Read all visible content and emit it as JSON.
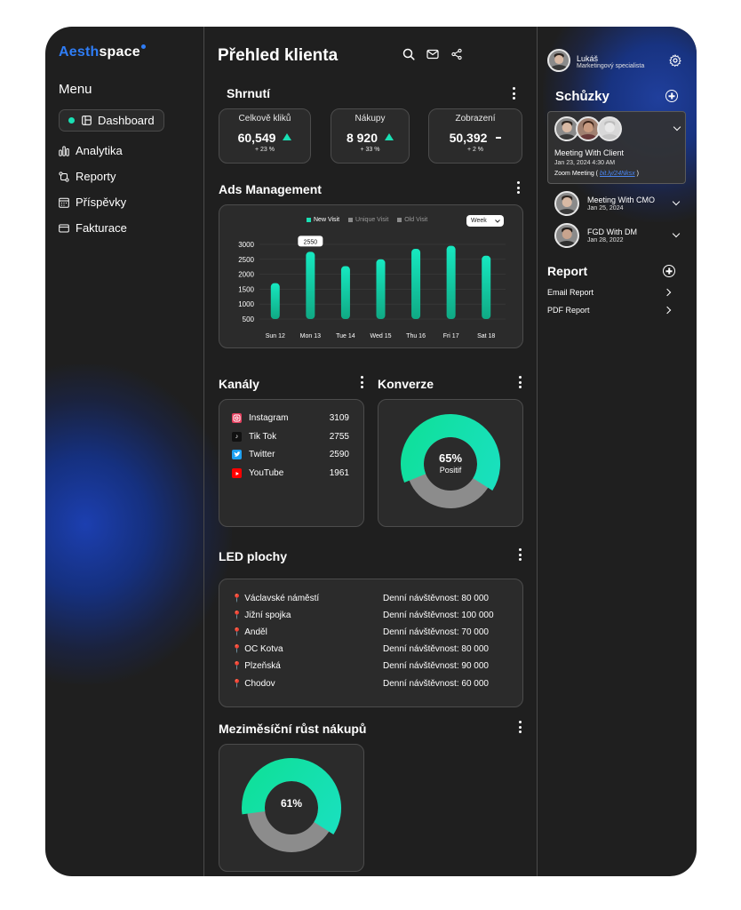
{
  "brand": {
    "part1": "Aesth",
    "part2": "space"
  },
  "sidebar": {
    "menu_title": "Menu",
    "items": [
      {
        "label": "Dashboard",
        "icon": "layout-icon",
        "active": true
      },
      {
        "label": "Analytika",
        "icon": "bar-chart-icon"
      },
      {
        "label": "Reporty",
        "icon": "flow-icon"
      },
      {
        "label": "Příspěvky",
        "icon": "calendar-icon"
      },
      {
        "label": "Fakturace",
        "icon": "card-icon"
      }
    ]
  },
  "header": {
    "title": "Přehled klienta",
    "icons": [
      "search-icon",
      "mail-icon",
      "share-icon"
    ]
  },
  "summary": {
    "title": "Shrnutí",
    "stats": [
      {
        "label": "Celkově kliků",
        "value": "60,549",
        "trend": "up",
        "delta": "+ 23 %"
      },
      {
        "label": "Nákupy",
        "value": "8 920",
        "trend": "up",
        "delta": "+ 33 %"
      },
      {
        "label": "Zobrazení",
        "value": "50,392",
        "trend": "flat",
        "delta": "+ 2 %"
      }
    ]
  },
  "ads": {
    "title": "Ads Management",
    "legend": [
      "New Visit",
      "Unique Visit",
      "Old Visit"
    ],
    "period": "Week",
    "tooltip": "2550"
  },
  "chart_data": {
    "type": "bar",
    "categories": [
      "Sun 12",
      "Mon 13",
      "Tue 14",
      "Wed 15",
      "Thu 16",
      "Fri 17",
      "Sat 18"
    ],
    "series": [
      {
        "name": "New Visit",
        "values": [
          1700,
          2750,
          2270,
          2500,
          2850,
          2950,
          2620
        ]
      }
    ],
    "yticks": [
      3000,
      2500,
      2000,
      1500,
      1000,
      500
    ],
    "ylim": [
      500,
      3000
    ],
    "grid": true,
    "legend_position": "top",
    "colors": {
      "bar_top": "#16e8c0",
      "bar_bottom": "#10a984",
      "legend_new": "#19e0b4",
      "legend_unique": "#8a8a8a",
      "legend_old": "#8a8a8a"
    }
  },
  "channels": {
    "title": "Kanály",
    "rows": [
      {
        "name": "Instagram",
        "value": "3109",
        "icon": "instagram-icon",
        "color": "#e4405f"
      },
      {
        "name": "Tik Tok",
        "value": "2755",
        "icon": "tiktok-icon",
        "color": "#111111"
      },
      {
        "name": "Twitter",
        "value": "2590",
        "icon": "twitter-icon",
        "color": "#1da1f2"
      },
      {
        "name": "YouTube",
        "value": "1961",
        "icon": "youtube-icon",
        "color": "#ff0000"
      }
    ]
  },
  "conversion": {
    "title": "Konverze",
    "percent": "65%",
    "label": "Positif",
    "fraction": 0.65
  },
  "led": {
    "title": "LED plochy",
    "rows": [
      {
        "place": "Václavské náměstí",
        "traffic": "Denní návštěvnost: 80 000"
      },
      {
        "place": "Jižní spojka",
        "traffic": "Denní návštěvnost: 100 000"
      },
      {
        "place": "Anděl",
        "traffic": "Denní návštěvnost: 70 000"
      },
      {
        "place": "OC Kotva",
        "traffic": "Denní návštěvnost: 80 000"
      },
      {
        "place": "Plzeňská",
        "traffic": "Denní návštěvnost: 90 000"
      },
      {
        "place": "Chodov",
        "traffic": "Denní návštěvnost: 60 000"
      }
    ]
  },
  "growth": {
    "title": "Meziměsíční růst nákupů",
    "percent": "61%",
    "fraction": 0.61
  },
  "user": {
    "name": "Lukáš",
    "role": "Marketingový specialista"
  },
  "meetings": {
    "title": "Schůzky",
    "featured": {
      "title": "Meeting With Client",
      "date": "Jan 23, 2024 4:30 AM",
      "zoom_prefix": "Zoom Meeting ( ",
      "link": "bit.ly/24Nksx",
      "zoom_suffix": " )"
    },
    "items": [
      {
        "title": "Meeting With CMO",
        "date": "Jan 25, 2024"
      },
      {
        "title": "FGD With DM",
        "date": "Jan 28, 2022"
      }
    ]
  },
  "report": {
    "title": "Report",
    "items": [
      "Email Report",
      "PDF Report"
    ]
  },
  "colors": {
    "accent": "#19e0b4",
    "panel": "#2b2b2b",
    "background": "#1f1f1f",
    "donut_gray": "#8c8c8c"
  }
}
